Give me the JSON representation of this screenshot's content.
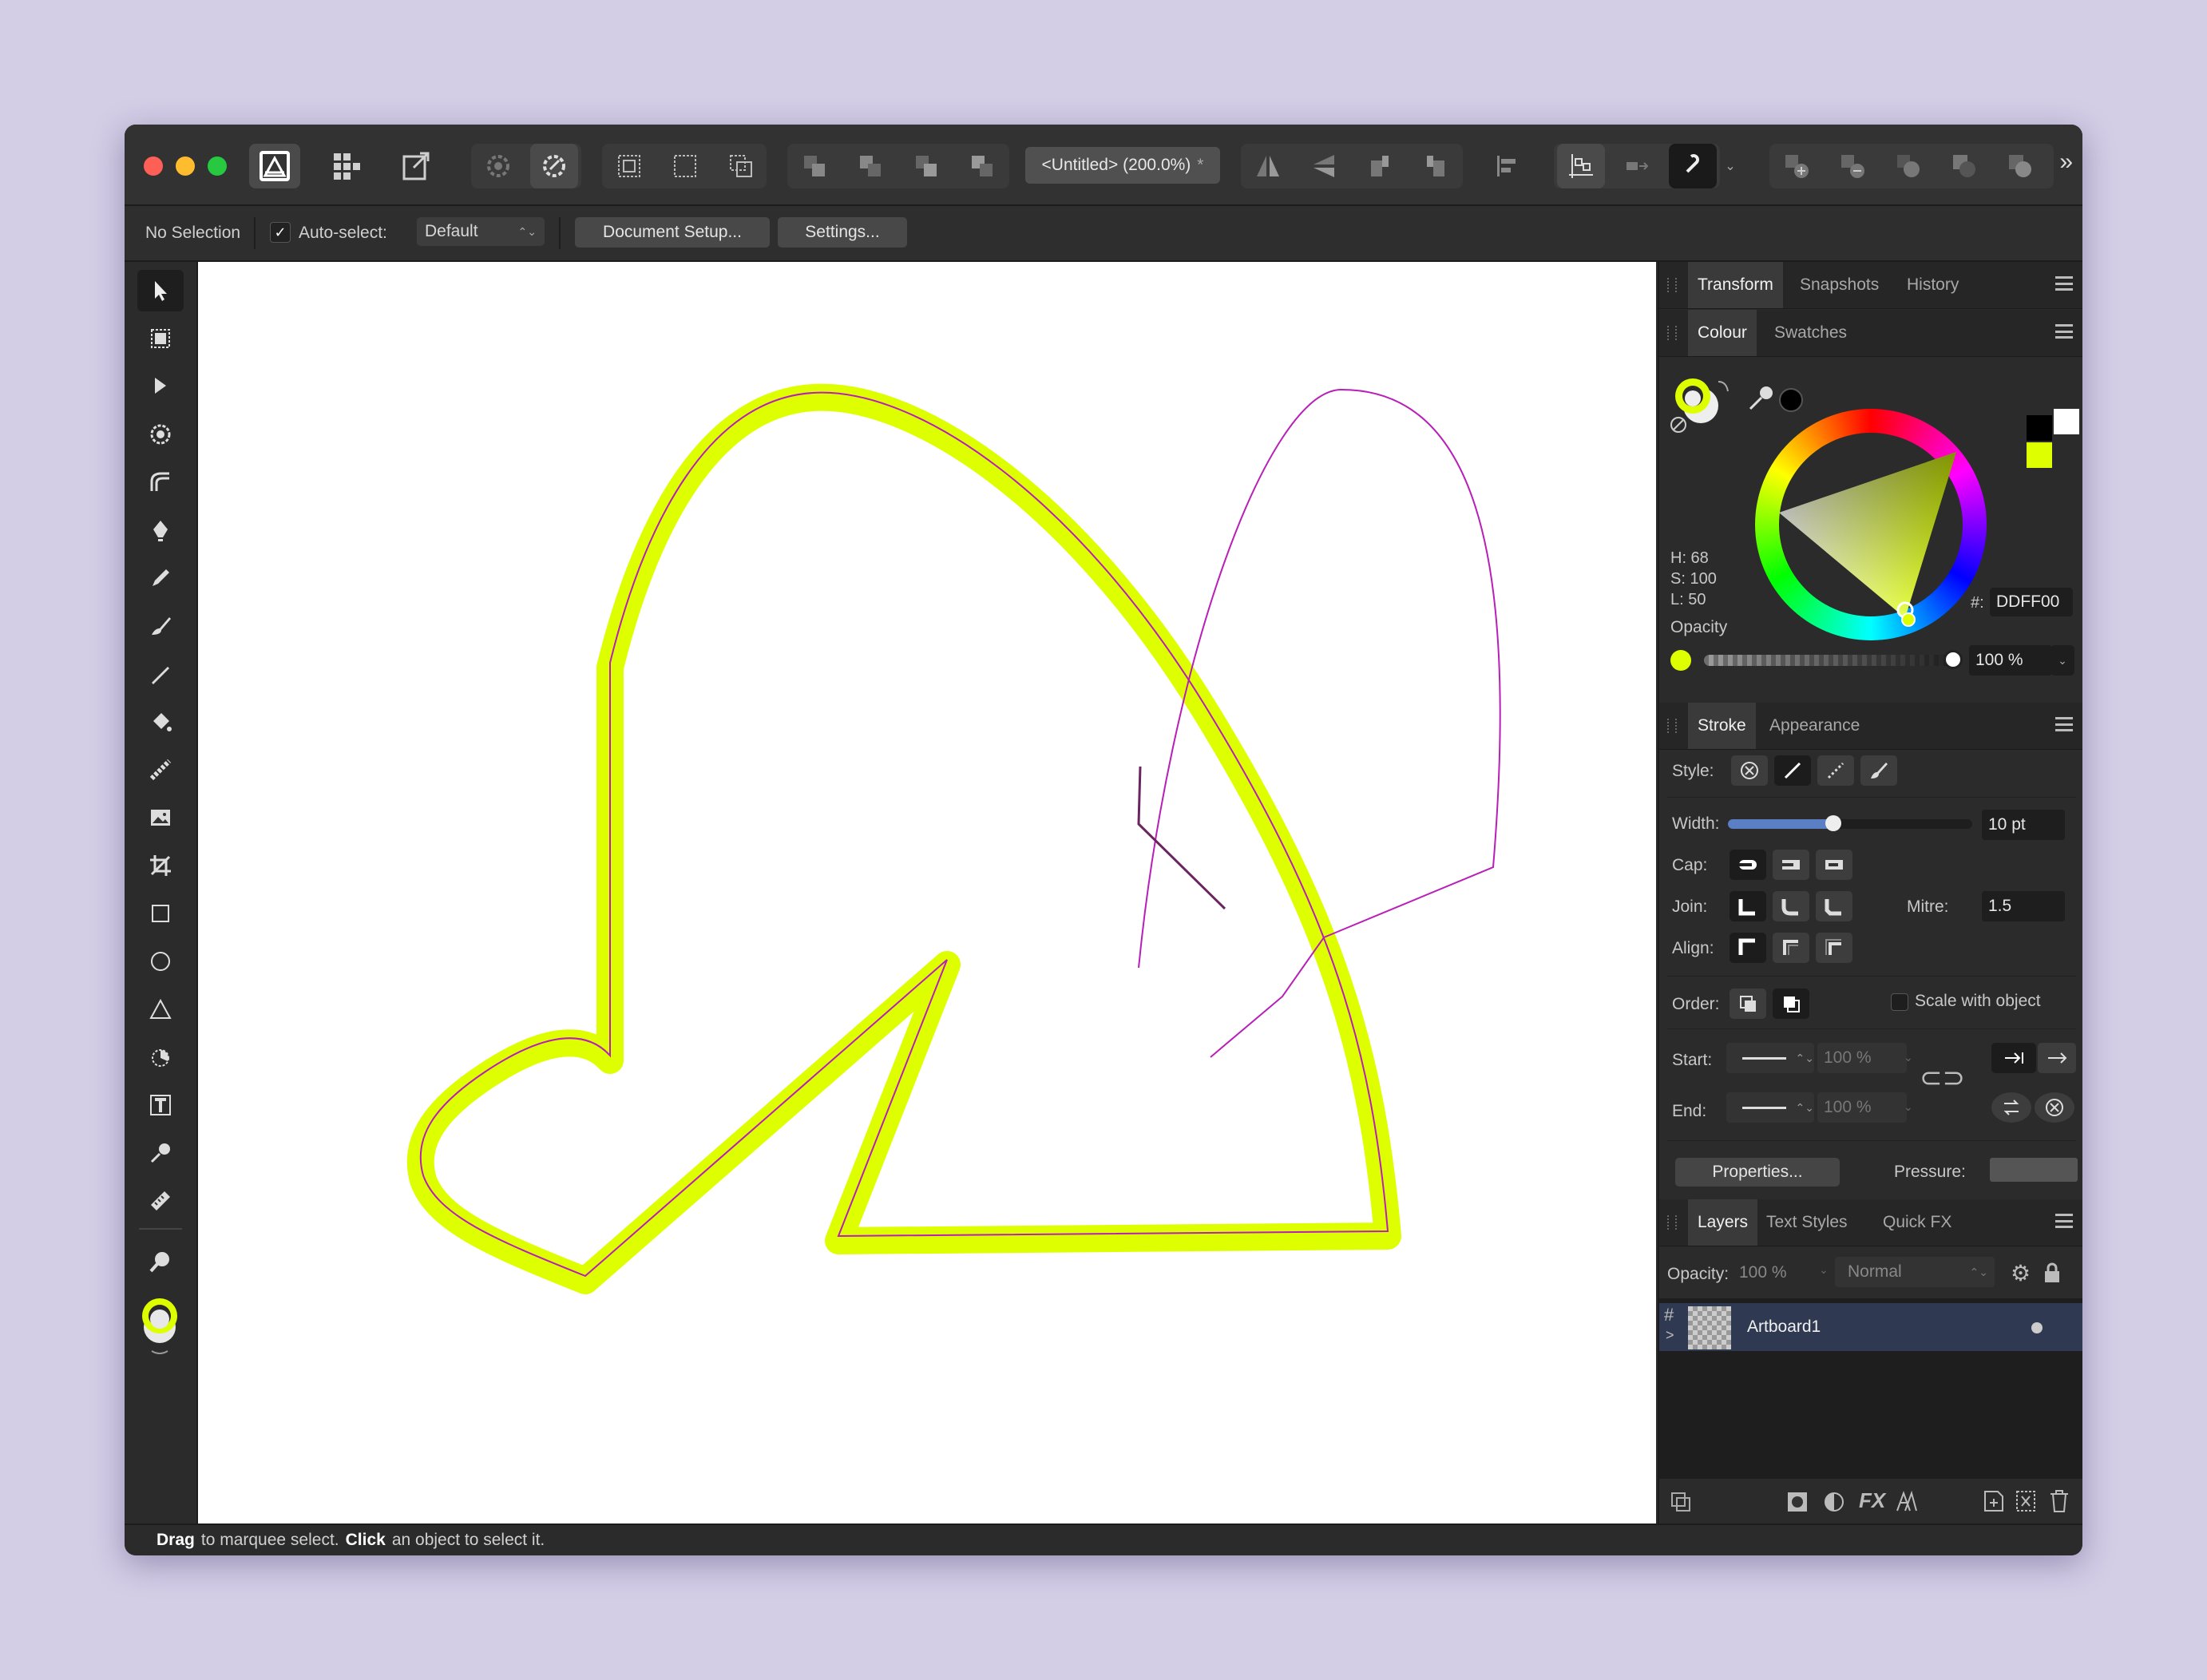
{
  "document": {
    "title": "<Untitled> (200.0%)",
    "modified_mark": "*"
  },
  "colors": {
    "accent": "#DDFF00",
    "selection_path": "#B81FB8"
  },
  "context_toolbar": {
    "selection": "No Selection",
    "auto_select_label": "Auto-select:",
    "auto_select_value": "Default",
    "document_setup": "Document Setup...",
    "settings": "Settings..."
  },
  "panels": {
    "top_tabs": [
      "Transform",
      "Snapshots",
      "History"
    ],
    "colour_tabs": [
      "Colour",
      "Swatches"
    ],
    "colour": {
      "h": "H: 68",
      "s": "S: 100",
      "l": "L: 50",
      "hex_label": "#:",
      "hex": "DDFF00",
      "opacity_label": "Opacity",
      "opacity": "100 %"
    },
    "stroke_tabs": [
      "Stroke",
      "Appearance"
    ],
    "stroke": {
      "style_label": "Style:",
      "width_label": "Width:",
      "width": "10 pt",
      "width_fraction": 0.43,
      "cap_label": "Cap:",
      "join_label": "Join:",
      "mitre_label": "Mitre:",
      "mitre": "1.5",
      "align_label": "Align:",
      "order_label": "Order:",
      "scale_label": "Scale with object",
      "start_label": "Start:",
      "start_value": "100 %",
      "end_label": "End:",
      "end_value": "100 %",
      "properties": "Properties...",
      "pressure_label": "Pressure:"
    },
    "layers_tabs": [
      "Layers",
      "Text Styles",
      "Quick FX"
    ],
    "layers": {
      "opacity_label": "Opacity:",
      "opacity": "100 %",
      "blend": "Normal",
      "items": [
        {
          "name": "Artboard1"
        }
      ]
    }
  },
  "status": {
    "drag": "Drag",
    "drag_text": "to marquee select.",
    "click": "Click",
    "click_text": "an object to select it."
  }
}
